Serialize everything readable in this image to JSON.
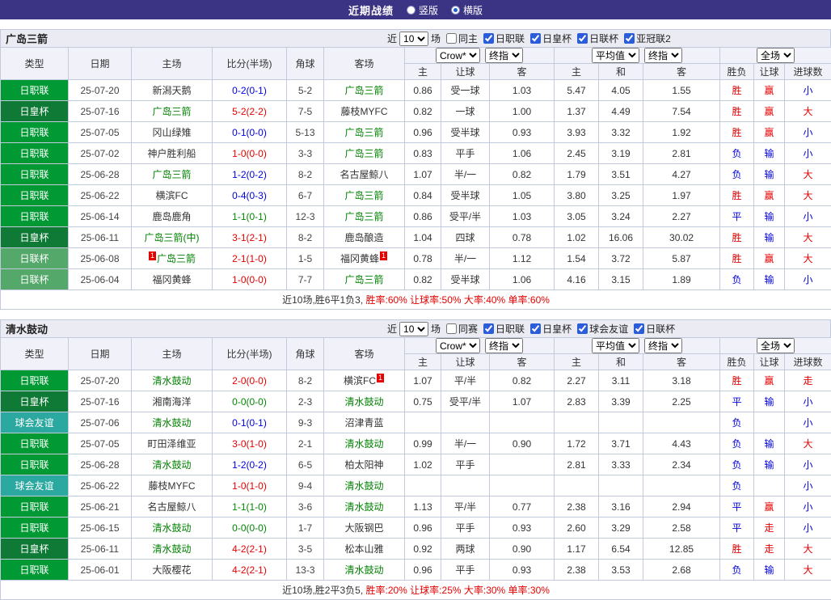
{
  "topbar": {
    "title": "近期战绩",
    "radio_vertical": "竖版",
    "radio_horizontal": "横版",
    "selected": "横版"
  },
  "colors": {
    "red": "#e60000",
    "blue": "#0000dd",
    "green": "#008800",
    "focus_team": "#008000",
    "text_dark": "#333333",
    "league": {
      "日职联": "#009933",
      "日皇杯": "#0e7a35",
      "日联杯": "#54a86a",
      "球会友谊": "#2ba8a0"
    }
  },
  "sections": [
    {
      "team": "广岛三箭",
      "filter": {
        "near": "近",
        "count": "10",
        "games": "场",
        "same": "同主",
        "leagues": [
          "日职联",
          "日皇杯",
          "日联杯",
          "亚冠联2"
        ]
      },
      "header": {
        "type": "类型",
        "date": "日期",
        "home": "主场",
        "score": "比分(半场)",
        "corner": "角球",
        "away": "客场",
        "company": "Crow*",
        "final1": "终指",
        "avg": "平均值",
        "final2": "终指",
        "scope": "全场",
        "sub": [
          "主",
          "让球",
          "客",
          "主",
          "和",
          "客",
          "胜负",
          "让球",
          "进球数"
        ]
      },
      "rows": [
        {
          "league": "日职联",
          "date": "25-07-20",
          "home": "新潟天鹅",
          "hf": 0,
          "hb": "",
          "score": "0-2(0-1)",
          "sc": "blue",
          "corner": "5-2",
          "away": "广岛三箭",
          "af": 1,
          "ab": "",
          "odds": [
            "0.86",
            "受一球",
            "1.03"
          ],
          "avg": [
            "5.47",
            "4.05",
            "1.55"
          ],
          "res": [
            [
              "胜",
              "red"
            ],
            [
              "赢",
              "red"
            ],
            [
              "小",
              "blue"
            ]
          ]
        },
        {
          "league": "日皇杯",
          "date": "25-07-16",
          "home": "广岛三箭",
          "hf": 1,
          "hb": "",
          "score": "5-2(2-2)",
          "sc": "red",
          "corner": "7-5",
          "away": "藤枝MYFC",
          "af": 0,
          "ab": "",
          "odds": [
            "0.82",
            "一球",
            "1.00"
          ],
          "avg": [
            "1.37",
            "4.49",
            "7.54"
          ],
          "res": [
            [
              "胜",
              "red"
            ],
            [
              "赢",
              "red"
            ],
            [
              "大",
              "red"
            ]
          ]
        },
        {
          "league": "日职联",
          "date": "25-07-05",
          "home": "冈山绿雉",
          "hf": 0,
          "hb": "",
          "score": "0-1(0-0)",
          "sc": "blue",
          "corner": "5-13",
          "away": "广岛三箭",
          "af": 1,
          "ab": "",
          "odds": [
            "0.96",
            "受半球",
            "0.93"
          ],
          "avg": [
            "3.93",
            "3.32",
            "1.92"
          ],
          "res": [
            [
              "胜",
              "red"
            ],
            [
              "赢",
              "red"
            ],
            [
              "小",
              "blue"
            ]
          ]
        },
        {
          "league": "日职联",
          "date": "25-07-02",
          "home": "神户胜利船",
          "hf": 0,
          "hb": "",
          "score": "1-0(0-0)",
          "sc": "red",
          "corner": "3-3",
          "away": "广岛三箭",
          "af": 1,
          "ab": "",
          "odds": [
            "0.83",
            "平手",
            "1.06"
          ],
          "avg": [
            "2.45",
            "3.19",
            "2.81"
          ],
          "res": [
            [
              "负",
              "blue"
            ],
            [
              "输",
              "blue"
            ],
            [
              "小",
              "blue"
            ]
          ]
        },
        {
          "league": "日职联",
          "date": "25-06-28",
          "home": "广岛三箭",
          "hf": 1,
          "hb": "",
          "score": "1-2(0-2)",
          "sc": "blue",
          "corner": "8-2",
          "away": "名古屋鲸八",
          "af": 0,
          "ab": "",
          "odds": [
            "1.07",
            "半/一",
            "0.82"
          ],
          "avg": [
            "1.79",
            "3.51",
            "4.27"
          ],
          "res": [
            [
              "负",
              "blue"
            ],
            [
              "输",
              "blue"
            ],
            [
              "大",
              "red"
            ]
          ]
        },
        {
          "league": "日职联",
          "date": "25-06-22",
          "home": "横滨FC",
          "hf": 0,
          "hb": "",
          "score": "0-4(0-3)",
          "sc": "blue",
          "corner": "6-7",
          "away": "广岛三箭",
          "af": 1,
          "ab": "",
          "odds": [
            "0.84",
            "受半球",
            "1.05"
          ],
          "avg": [
            "3.80",
            "3.25",
            "1.97"
          ],
          "res": [
            [
              "胜",
              "red"
            ],
            [
              "赢",
              "red"
            ],
            [
              "大",
              "red"
            ]
          ]
        },
        {
          "league": "日职联",
          "date": "25-06-14",
          "home": "鹿岛鹿角",
          "hf": 0,
          "hb": "",
          "score": "1-1(0-1)",
          "sc": "green",
          "corner": "12-3",
          "away": "广岛三箭",
          "af": 1,
          "ab": "",
          "odds": [
            "0.86",
            "受平/半",
            "1.03"
          ],
          "avg": [
            "3.05",
            "3.24",
            "2.27"
          ],
          "res": [
            [
              "平",
              "blue"
            ],
            [
              "输",
              "blue"
            ],
            [
              "小",
              "blue"
            ]
          ]
        },
        {
          "league": "日皇杯",
          "date": "25-06-11",
          "home": "广岛三箭(中)",
          "hf": 1,
          "hb": "",
          "score": "3-1(2-1)",
          "sc": "red",
          "corner": "8-2",
          "away": "鹿岛酿造",
          "af": 0,
          "ab": "",
          "odds": [
            "1.04",
            "四球",
            "0.78"
          ],
          "avg": [
            "1.02",
            "16.06",
            "30.02"
          ],
          "res": [
            [
              "胜",
              "red"
            ],
            [
              "输",
              "blue"
            ],
            [
              "大",
              "red"
            ]
          ]
        },
        {
          "league": "日联杯",
          "date": "25-06-08",
          "home": "广岛三箭",
          "hf": 1,
          "hb": "1",
          "score": "2-1(1-0)",
          "sc": "red",
          "corner": "1-5",
          "away": "福冈黄蜂",
          "af": 0,
          "ab": "1",
          "odds": [
            "0.78",
            "半/一",
            "1.12"
          ],
          "avg": [
            "1.54",
            "3.72",
            "5.87"
          ],
          "res": [
            [
              "胜",
              "red"
            ],
            [
              "赢",
              "red"
            ],
            [
              "大",
              "red"
            ]
          ]
        },
        {
          "league": "日联杯",
          "date": "25-06-04",
          "home": "福冈黄蜂",
          "hf": 0,
          "hb": "",
          "score": "1-0(0-0)",
          "sc": "red",
          "corner": "7-7",
          "away": "广岛三箭",
          "af": 1,
          "ab": "",
          "odds": [
            "0.82",
            "受半球",
            "1.06"
          ],
          "avg": [
            "4.16",
            "3.15",
            "1.89"
          ],
          "res": [
            [
              "负",
              "blue"
            ],
            [
              "输",
              "blue"
            ],
            [
              "小",
              "blue"
            ]
          ]
        }
      ],
      "summary": [
        {
          "t": "近10场,胜6平1负3, ",
          "c": "#333333"
        },
        {
          "t": "胜率:60% 让球率:50% 大率:40% 单率:60%",
          "c": "#e60000"
        }
      ]
    },
    {
      "team": "清水鼓动",
      "filter": {
        "near": "近",
        "count": "10",
        "games": "场",
        "same": "同赛",
        "leagues": [
          "日职联",
          "日皇杯",
          "球会友谊",
          "日联杯"
        ]
      },
      "header": {
        "type": "类型",
        "date": "日期",
        "home": "主场",
        "score": "比分(半场)",
        "corner": "角球",
        "away": "客场",
        "company": "Crow*",
        "final1": "终指",
        "avg": "平均值",
        "final2": "终指",
        "scope": "全场",
        "sub": [
          "主",
          "让球",
          "客",
          "主",
          "和",
          "客",
          "胜负",
          "让球",
          "进球数"
        ]
      },
      "rows": [
        {
          "league": "日职联",
          "date": "25-07-20",
          "home": "清水鼓动",
          "hf": 1,
          "hb": "",
          "score": "2-0(0-0)",
          "sc": "red",
          "corner": "8-2",
          "away": "横滨FC",
          "af": 0,
          "ab": "1",
          "odds": [
            "1.07",
            "平/半",
            "0.82"
          ],
          "avg": [
            "2.27",
            "3.11",
            "3.18"
          ],
          "res": [
            [
              "胜",
              "red"
            ],
            [
              "赢",
              "red"
            ],
            [
              "走",
              "red"
            ]
          ]
        },
        {
          "league": "日皇杯",
          "date": "25-07-16",
          "home": "湘南海洋",
          "hf": 0,
          "hb": "",
          "score": "0-0(0-0)",
          "sc": "green",
          "corner": "2-3",
          "away": "清水鼓动",
          "af": 1,
          "ab": "",
          "odds": [
            "0.75",
            "受平/半",
            "1.07"
          ],
          "avg": [
            "2.83",
            "3.39",
            "2.25"
          ],
          "res": [
            [
              "平",
              "blue"
            ],
            [
              "输",
              "blue"
            ],
            [
              "小",
              "blue"
            ]
          ]
        },
        {
          "league": "球会友谊",
          "date": "25-07-06",
          "home": "清水鼓动",
          "hf": 1,
          "hb": "",
          "score": "0-1(0-1)",
          "sc": "blue",
          "corner": "9-3",
          "away": "沼津青蓝",
          "af": 0,
          "ab": "",
          "odds": [
            "",
            "",
            ""
          ],
          "avg": [
            "",
            "",
            ""
          ],
          "res": [
            [
              "负",
              "blue"
            ],
            [
              "",
              ""
            ],
            [
              "小",
              "blue"
            ]
          ]
        },
        {
          "league": "日职联",
          "date": "25-07-05",
          "home": "町田泽维亚",
          "hf": 0,
          "hb": "",
          "score": "3-0(1-0)",
          "sc": "red",
          "corner": "2-1",
          "away": "清水鼓动",
          "af": 1,
          "ab": "",
          "odds": [
            "0.99",
            "半/一",
            "0.90"
          ],
          "avg": [
            "1.72",
            "3.71",
            "4.43"
          ],
          "res": [
            [
              "负",
              "blue"
            ],
            [
              "输",
              "blue"
            ],
            [
              "大",
              "red"
            ]
          ]
        },
        {
          "league": "日职联",
          "date": "25-06-28",
          "home": "清水鼓动",
          "hf": 1,
          "hb": "",
          "score": "1-2(0-2)",
          "sc": "blue",
          "corner": "6-5",
          "away": "柏太阳神",
          "af": 0,
          "ab": "",
          "odds": [
            "1.02",
            "平手",
            ""
          ],
          "avg": [
            "2.81",
            "3.33",
            "2.34"
          ],
          "res": [
            [
              "负",
              "blue"
            ],
            [
              "输",
              "blue"
            ],
            [
              "小",
              "blue"
            ]
          ]
        },
        {
          "league": "球会友谊",
          "date": "25-06-22",
          "home": "藤枝MYFC",
          "hf": 0,
          "hb": "",
          "score": "1-0(1-0)",
          "sc": "red",
          "corner": "9-4",
          "away": "清水鼓动",
          "af": 1,
          "ab": "",
          "odds": [
            "",
            "",
            ""
          ],
          "avg": [
            "",
            "",
            ""
          ],
          "res": [
            [
              "负",
              "blue"
            ],
            [
              "",
              ""
            ],
            [
              "小",
              "blue"
            ]
          ]
        },
        {
          "league": "日职联",
          "date": "25-06-21",
          "home": "名古屋鲸八",
          "hf": 0,
          "hb": "",
          "score": "1-1(1-0)",
          "sc": "green",
          "corner": "3-6",
          "away": "清水鼓动",
          "af": 1,
          "ab": "",
          "odds": [
            "1.13",
            "平/半",
            "0.77"
          ],
          "avg": [
            "2.38",
            "3.16",
            "2.94"
          ],
          "res": [
            [
              "平",
              "blue"
            ],
            [
              "赢",
              "red"
            ],
            [
              "小",
              "blue"
            ]
          ]
        },
        {
          "league": "日职联",
          "date": "25-06-15",
          "home": "清水鼓动",
          "hf": 1,
          "hb": "",
          "score": "0-0(0-0)",
          "sc": "green",
          "corner": "1-7",
          "away": "大阪钢巴",
          "af": 0,
          "ab": "",
          "odds": [
            "0.96",
            "平手",
            "0.93"
          ],
          "avg": [
            "2.60",
            "3.29",
            "2.58"
          ],
          "res": [
            [
              "平",
              "blue"
            ],
            [
              "走",
              "red"
            ],
            [
              "小",
              "blue"
            ]
          ]
        },
        {
          "league": "日皇杯",
          "date": "25-06-11",
          "home": "清水鼓动",
          "hf": 1,
          "hb": "",
          "score": "4-2(2-1)",
          "sc": "red",
          "corner": "3-5",
          "away": "松本山雅",
          "af": 0,
          "ab": "",
          "odds": [
            "0.92",
            "两球",
            "0.90"
          ],
          "avg": [
            "1.17",
            "6.54",
            "12.85"
          ],
          "res": [
            [
              "胜",
              "red"
            ],
            [
              "走",
              "red"
            ],
            [
              "大",
              "red"
            ]
          ]
        },
        {
          "league": "日职联",
          "date": "25-06-01",
          "home": "大阪樱花",
          "hf": 0,
          "hb": "",
          "score": "4-2(2-1)",
          "sc": "red",
          "corner": "13-3",
          "away": "清水鼓动",
          "af": 1,
          "ab": "",
          "odds": [
            "0.96",
            "平手",
            "0.93"
          ],
          "avg": [
            "2.38",
            "3.53",
            "2.68"
          ],
          "res": [
            [
              "负",
              "blue"
            ],
            [
              "输",
              "blue"
            ],
            [
              "大",
              "red"
            ]
          ]
        }
      ],
      "summary": [
        {
          "t": "近10场,胜2平3负5, ",
          "c": "#333333"
        },
        {
          "t": "胜率:20% 让球率:25% 大率:30% 单率:30%",
          "c": "#e60000"
        }
      ]
    }
  ]
}
